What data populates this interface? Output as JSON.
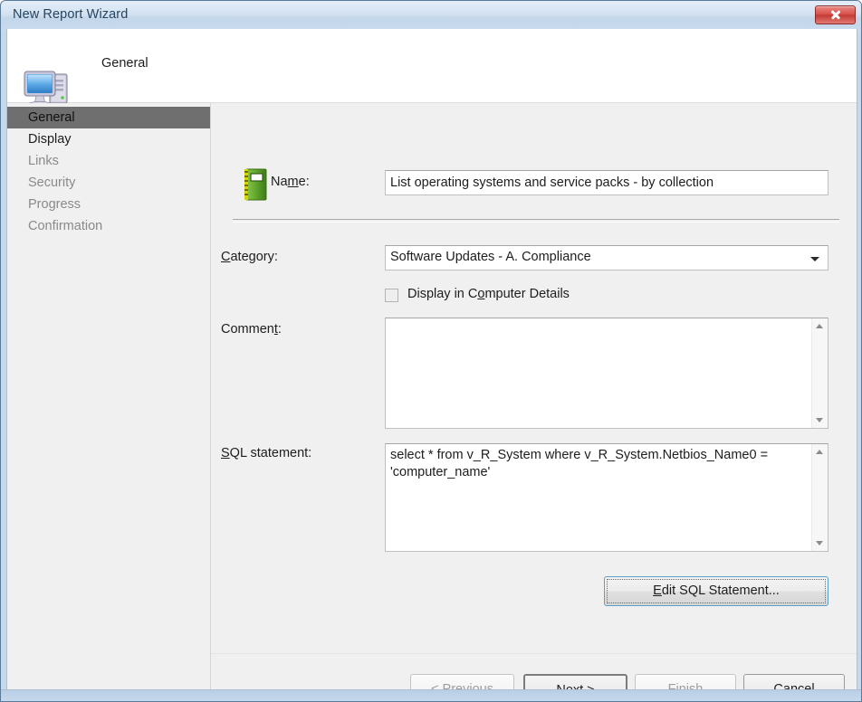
{
  "window": {
    "title": "New Report Wizard",
    "close_label": "Close"
  },
  "header": {
    "title": "General",
    "icon": "computer-icon"
  },
  "sidebar": {
    "items": [
      {
        "label": "General",
        "state": "selected"
      },
      {
        "label": "Display",
        "state": "available"
      },
      {
        "label": "Links",
        "state": "disabled"
      },
      {
        "label": "Security",
        "state": "disabled"
      },
      {
        "label": "Progress",
        "state": "disabled"
      },
      {
        "label": "Confirmation",
        "state": "disabled"
      }
    ]
  },
  "form": {
    "name": {
      "icon": "notebook-icon",
      "label_pre": "Na",
      "label_accel": "m",
      "label_post": "e:",
      "value": "List operating systems and service packs - by collection"
    },
    "category": {
      "label_pre": "",
      "label_accel": "C",
      "label_post": "ategory:",
      "value": "Software Updates - A. Compliance",
      "arrow_icon": "chevron-down-icon"
    },
    "display_in_computer_details": {
      "label_pre": "Display in C",
      "label_accel": "o",
      "label_post": "mputer Details",
      "checked": false
    },
    "comment": {
      "label_pre": "Commen",
      "label_accel": "t",
      "label_post": ":",
      "value": "",
      "scroll_up_icon": "scroll-up-icon",
      "scroll_down_icon": "scroll-down-icon"
    },
    "sql_statement": {
      "label_pre": "",
      "label_accel": "S",
      "label_post": "QL statement:",
      "value": "select * from v_R_System where v_R_System.Netbios_Name0 = 'computer_name'",
      "scroll_up_icon": "scroll-up-icon",
      "scroll_down_icon": "scroll-down-icon"
    },
    "edit_sql_button": {
      "label_pre": "",
      "label_accel": "E",
      "label_post": "dit SQL Statement...",
      "focused": true
    }
  },
  "footer": {
    "previous": {
      "label_pre": "< ",
      "label_accel": "P",
      "label_post": "revious",
      "enabled": false
    },
    "next": {
      "label_pre": "",
      "label_accel": "N",
      "label_post": "ext >",
      "enabled": true,
      "default": true
    },
    "finish": {
      "label_pre": "",
      "label_accel": "F",
      "label_post": "inish",
      "enabled": false
    },
    "cancel": {
      "label_pre": "Cancel",
      "label_accel": "",
      "label_post": "",
      "enabled": true
    }
  },
  "colors": {
    "accent_focus": "#5a9ec9",
    "selection": "#6f6f6f",
    "panel": "#f0f0f0",
    "close_button": "#c23a35",
    "title_text": "#26445f"
  }
}
